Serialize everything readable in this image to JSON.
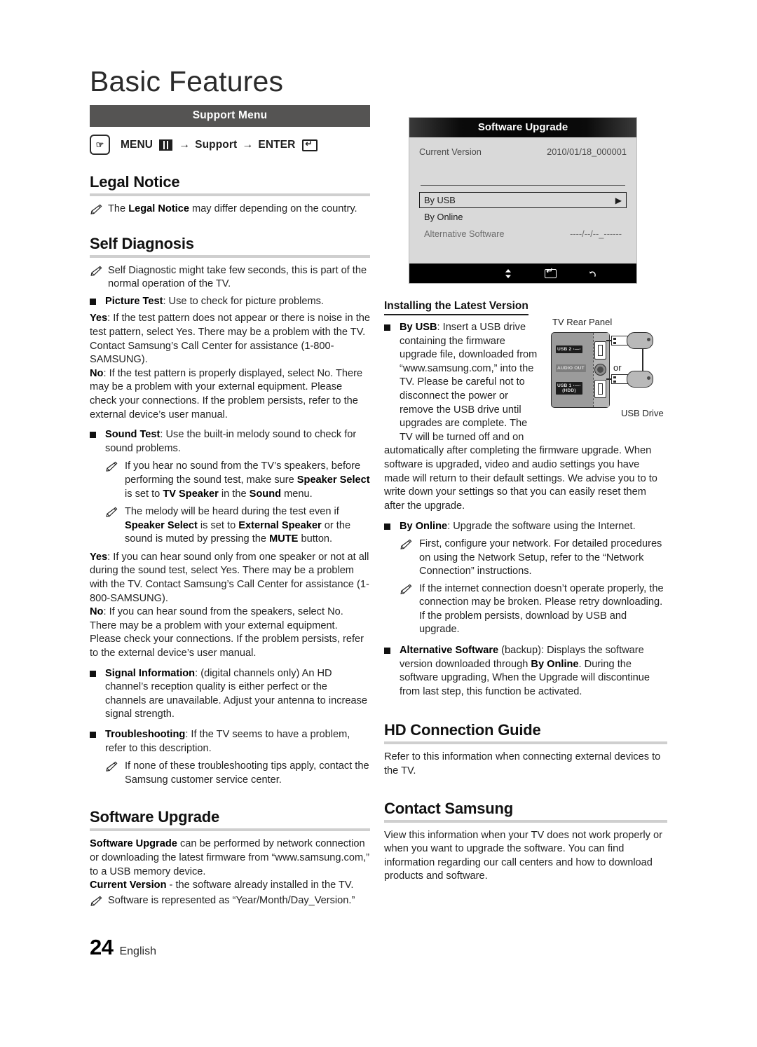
{
  "page": {
    "title": "Basic Features",
    "number": "24",
    "language": "English"
  },
  "support_menu": {
    "bar_label": "Support Menu",
    "path": {
      "menu_label": "MENU",
      "arrow": "→",
      "middle_label": "Support",
      "enter_label": "ENTER",
      "hand_icon": "hand-press-icon",
      "menu_icon": "menu-grid-icon",
      "enter_icon": "enter-key-icon"
    }
  },
  "left_column": {
    "legal_notice": {
      "heading": "Legal Notice",
      "note": "The <b>Legal Notice</b> may differ depending on the country."
    },
    "self_diagnosis": {
      "heading": "Self Diagnosis",
      "note_intro": "Self Diagnostic might take few seconds, this is part of the normal operation of the TV.",
      "picture_test": {
        "label": "Picture Test",
        "desc": ": Use to check for picture problems.",
        "yes_label": "Yes",
        "yes_text": ": If the test pattern does not appear or there is noise in the test pattern, select Yes. There may be a problem with the TV. Contact Samsung’s Call Center for assistance (1-800-SAMSUNG).",
        "no_label": "No",
        "no_text": ": If the test pattern is properly displayed, select No. There may be a problem with your external equipment. Please check your connections. If the problem persists, refer to the external device’s user manual."
      },
      "sound_test": {
        "label": "Sound Test",
        "desc": ": Use the built-in melody sound to check for sound problems.",
        "note1": "If you hear no sound from the TV’s speakers, before performing the sound test, make sure <b>Speaker Select</b> is set to <b>TV Speaker</b> in the <b>Sound</b> menu.",
        "note2": "The melody will be heard during the test even if <b>Speaker Select</b> is set to <b>External Speaker</b> or the sound is muted by pressing the <b>MUTE</b> button.",
        "yes_label": "Yes",
        "yes_text": ": If you can hear sound only from one speaker or not at all during the sound test, select Yes. There may be a problem with the TV. Contact Samsung’s Call Center for assistance (1-800-SAMSUNG).",
        "no_label": "No",
        "no_text": ": If you can hear sound from the speakers, select No. There may be a problem with your external equipment. Please check your connections. If the problem persists, refer to the external device’s user manual."
      },
      "signal_information": {
        "label": "Signal Information",
        "desc": ": (digital channels only) An HD channel’s reception quality is either perfect or the channels are unavailable. Adjust your antenna to increase signal strength."
      },
      "troubleshooting": {
        "label": "Troubleshooting",
        "desc": ": If the TV seems to have a problem, refer to this description.",
        "note": "If none of these troubleshooting tips apply, contact the Samsung customer service center."
      }
    },
    "software_upgrade": {
      "heading": "Software Upgrade",
      "para1": "<b>Software Upgrade</b> can be performed by network connection or downloading the latest firmware from “www.samsung.com,” to a USB memory device.",
      "para2": "<b>Current Version</b> - the software already installed in the TV.",
      "note": "Software is represented as “Year/Month/Day_Version.”"
    }
  },
  "osd": {
    "title": "Software Upgrade",
    "current_version_label": "Current Version",
    "current_version_value": "2010/01/18_000001",
    "items": [
      {
        "label": "By USB",
        "value": "",
        "selected": true,
        "dim": false,
        "caret": "▶"
      },
      {
        "label": "By Online",
        "value": "",
        "selected": false,
        "dim": false,
        "caret": ""
      },
      {
        "label": "Alternative Software",
        "value": "----/--/--_------",
        "selected": false,
        "dim": true,
        "caret": ""
      }
    ],
    "footer": {
      "move": "Move",
      "move_icon": "up-down-arrow-icon",
      "enter": "Enter",
      "enter_icon": "enter-key-icon",
      "return": "Return",
      "return_icon": "return-arrow-icon"
    }
  },
  "diagram": {
    "title": "TV Rear Panel",
    "or_label": "or",
    "device_label": "USB Drive",
    "port_top": "USB 2",
    "port_audio": "AUDIO OUT",
    "port_bottom_line1": "USB 1",
    "port_bottom_line2": "(HDD)"
  },
  "right_column": {
    "installing": {
      "heading": "Installing the Latest Version",
      "by_usb_label": "By USB",
      "by_usb_text": ": Insert a USB drive containing the firmware upgrade file, downloaded from “www.samsung.com,” into the TV. Please be careful not to disconnect the power or remove the USB drive until upgrades are complete. The TV will be turned off and on",
      "by_usb_text_cont": "automatically after completing the firmware upgrade. When software is upgraded, video and audio settings you have made will return to their default settings. We advise you to to write down your settings so that you can easily reset them after the upgrade.",
      "by_online_label": "By Online",
      "by_online_text": ": Upgrade the software using the Internet.",
      "by_online_note1": "First, configure your network. For detailed procedures on using the Network Setup, refer to the “Network Connection” instructions.",
      "by_online_note2": "If the internet connection doesn’t operate properly, the connection may be broken. Please retry downloading. If the problem persists, download by USB and upgrade.",
      "alternative_label": "Alternative Software",
      "alternative_text": " (backup): Displays the software version downloaded through <b>By Online</b>. During the software upgrading, When the Upgrade will discontinue from last step, this function be activated."
    },
    "hd_connection_guide": {
      "heading": "HD Connection Guide",
      "text": "Refer to this information when connecting external devices to the TV."
    },
    "contact_samsung": {
      "heading": "Contact Samsung",
      "text": "View this information when your TV does not work properly or when you want to upgrade the software. You can find information regarding our call centers and how to download products and software."
    }
  }
}
